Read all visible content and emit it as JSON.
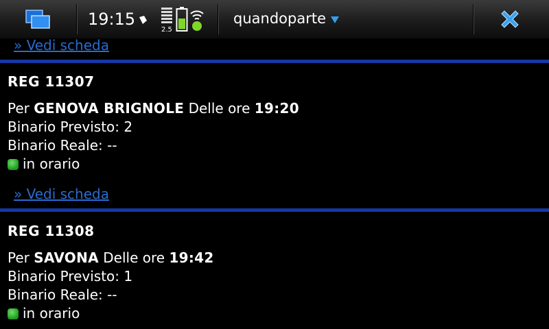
{
  "statusbar": {
    "time": "19:15",
    "network_label": "2.5",
    "app_title": "quandoparte",
    "icons": [
      "task-switcher-icon",
      "alarm-icon",
      "signal-strength-icon",
      "battery-icon",
      "wifi-icon",
      "dropdown-arrow-icon",
      "close-icon"
    ],
    "accent_color": "#2ea1ec"
  },
  "content": {
    "link_label": "» Vedi scheda",
    "divider_color": "#1638a4",
    "trains": [
      {
        "title": "REG 11307",
        "per_label": "Per",
        "destination": "GENOVA BRIGNOLE",
        "time_label": "Delle ore",
        "time": "19:20",
        "platform_planned": "Binario Previsto: 2",
        "platform_actual": "Binario Reale: --",
        "status": "in orario",
        "status_color": "#2fb82a"
      },
      {
        "title": "REG 11308",
        "per_label": "Per",
        "destination": "SAVONA",
        "time_label": "Delle ore",
        "time": "19:42",
        "platform_planned": "Binario Previsto: 1",
        "platform_actual": "Binario Reale: --",
        "status": "in orario",
        "status_color": "#2fb82a"
      }
    ]
  }
}
